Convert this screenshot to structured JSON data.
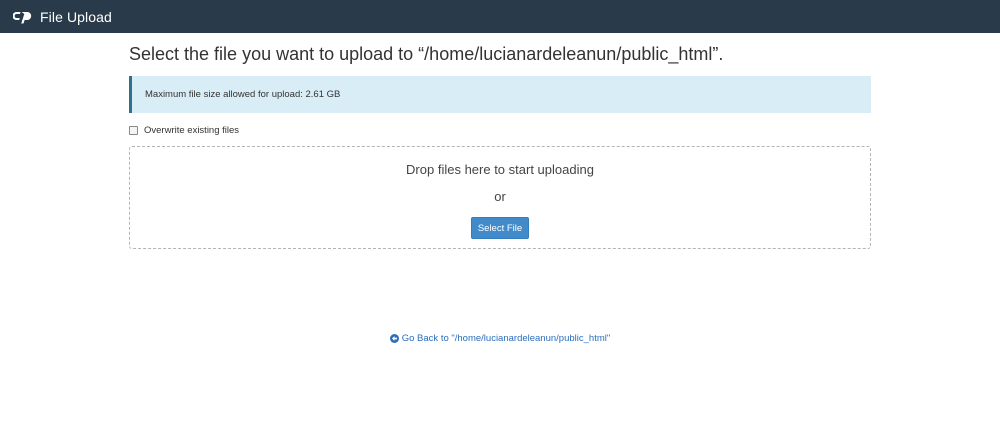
{
  "header": {
    "logo_icon": "cpanel-logo-icon",
    "title": "File Upload",
    "background_color": "#293a4a"
  },
  "main": {
    "heading": "Select the file you want to upload to “/home/lucianardeleanun/public_html”.",
    "info_text": "Maximum file size allowed for upload: 2.61 GB",
    "overwrite_label": "Overwrite existing files",
    "overwrite_checked": false
  },
  "dropzone": {
    "drop_text": "Drop files here to start uploading",
    "or_text": "or",
    "select_button_label": "Select File",
    "button_color": "#428bca"
  },
  "footer": {
    "back_icon": "arrow-circle-left-icon",
    "go_back_label": "Go Back to \"/home/lucianardeleanun/public_html\"",
    "link_color": "#2a6ebd"
  }
}
